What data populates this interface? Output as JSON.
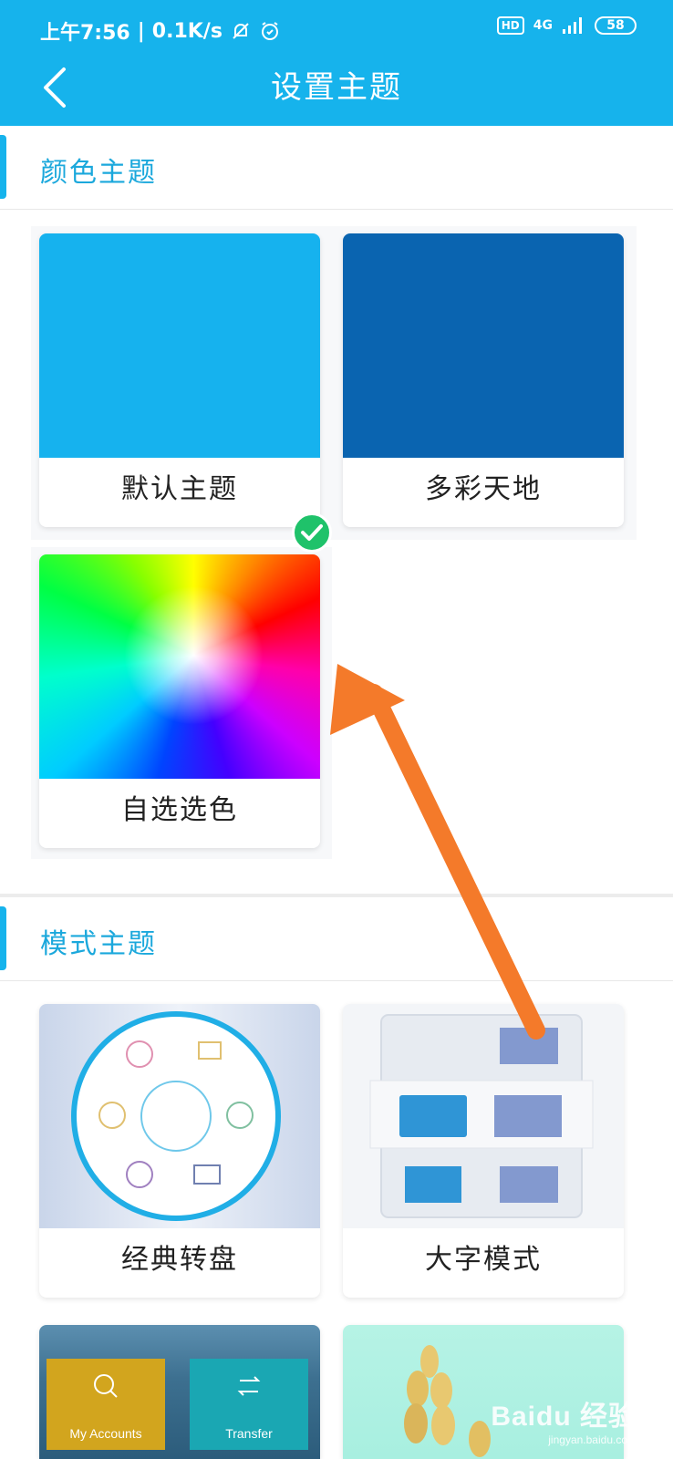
{
  "status_bar": {
    "time": "上午7:56",
    "speed": "0.1K/s",
    "hd": "HD",
    "network": "4G",
    "battery": "58"
  },
  "header": {
    "title": "设置主题",
    "back_icon": "chevron-left-icon"
  },
  "color_section": {
    "title": "颜色主题",
    "items": [
      {
        "label": "默认主题",
        "color": "#16b2ee",
        "selected": true
      },
      {
        "label": "多彩天地",
        "color": "#0a64b0",
        "selected": false
      },
      {
        "label": "自选选色",
        "color": "rainbow",
        "selected": false
      }
    ]
  },
  "mode_section": {
    "title": "模式主题",
    "items": [
      {
        "label": "经典转盘"
      },
      {
        "label": "大字模式"
      }
    ],
    "partial_cards": [
      {
        "tiles": [
          "My Accounts",
          "Transfer"
        ]
      },
      {
        "tiles": []
      }
    ]
  },
  "watermark": {
    "brand": "Baidu 经验",
    "url": "jingyan.baidu.com"
  },
  "colors": {
    "accent": "#16b3ec",
    "check": "#1fc26a",
    "arrow": "#f47a2a"
  }
}
